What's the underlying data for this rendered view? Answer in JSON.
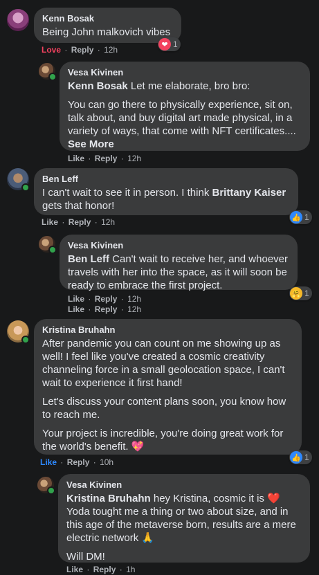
{
  "comments": {
    "c1": {
      "author": "Kenn Bosak",
      "text": "Being John malkovich vibes",
      "action_like": "Love",
      "action_reply": "Reply",
      "time": "12h",
      "reaction_count": "1",
      "reaction_icon": "heart-icon"
    },
    "r1": {
      "author": "Vesa Kivinen",
      "mention": "Kenn Bosak",
      "text_after_mention": " Let me elaborate, bro bro:",
      "para2": "You can go there to physically experience, sit on, talk about, and buy digital art made physical, in a variety of ways, that come with NFT certificates....",
      "see_more": "See More",
      "action_like": "Like",
      "action_reply": "Reply",
      "time": "12h"
    },
    "c2": {
      "author": "Ben Leff",
      "text_before_mention": "I can't wait to see it in person. I think ",
      "mention": "Brittany Kaiser",
      "text_after_mention": " gets that honor!",
      "action_like": "Like",
      "action_reply": "Reply",
      "time": "12h",
      "reaction_count": "1",
      "reaction_icon": "thumbs-up-icon"
    },
    "r2": {
      "author": "Vesa Kivinen",
      "mention": "Ben Leff",
      "text_after_mention": " Can't wait to receive her, and whoever travels with her into the space, as it will soon be ready to embrace the first project.",
      "action_like": "Like",
      "action_reply": "Reply",
      "time": "12h",
      "reaction_count": "1",
      "reaction_icon": "care-icon",
      "action2_like": "Like",
      "action2_reply": "Reply",
      "time2": "12h"
    },
    "c3": {
      "author": "Kristina Bruhahn",
      "para1": "After pandemic you can count on me showing up as well! I feel like you've created a cosmic creativity channeling force in a small geolocation space, I can't wait to experience it first hand!",
      "para2": "Let's discuss your content plans soon, you know how to reach me.",
      "para3": "Your project is incredible, you're doing great work for the world's benefit. 💖",
      "action_like": "Like",
      "action_reply": "Reply",
      "time": "10h",
      "reaction_count": "1",
      "reaction_icon": "thumbs-up-icon"
    },
    "r3": {
      "author": "Vesa Kivinen",
      "mention": "Kristina Bruhahn",
      "text_after_mention": " hey Kristina, cosmic it is ❤️ Yoda tought me a thing or two about size, and in this age of the metaverse born, results are a mere electric network 🙏",
      "para2": "Will DM!",
      "action_like": "Like",
      "action_reply": "Reply",
      "time": "1h"
    }
  },
  "separator": "·",
  "colors": {
    "background": "#18191a",
    "bubble": "#3a3b3c",
    "like_blue": "#2d88ff",
    "love_red": "#f3425f",
    "online_green": "#31a24c"
  }
}
